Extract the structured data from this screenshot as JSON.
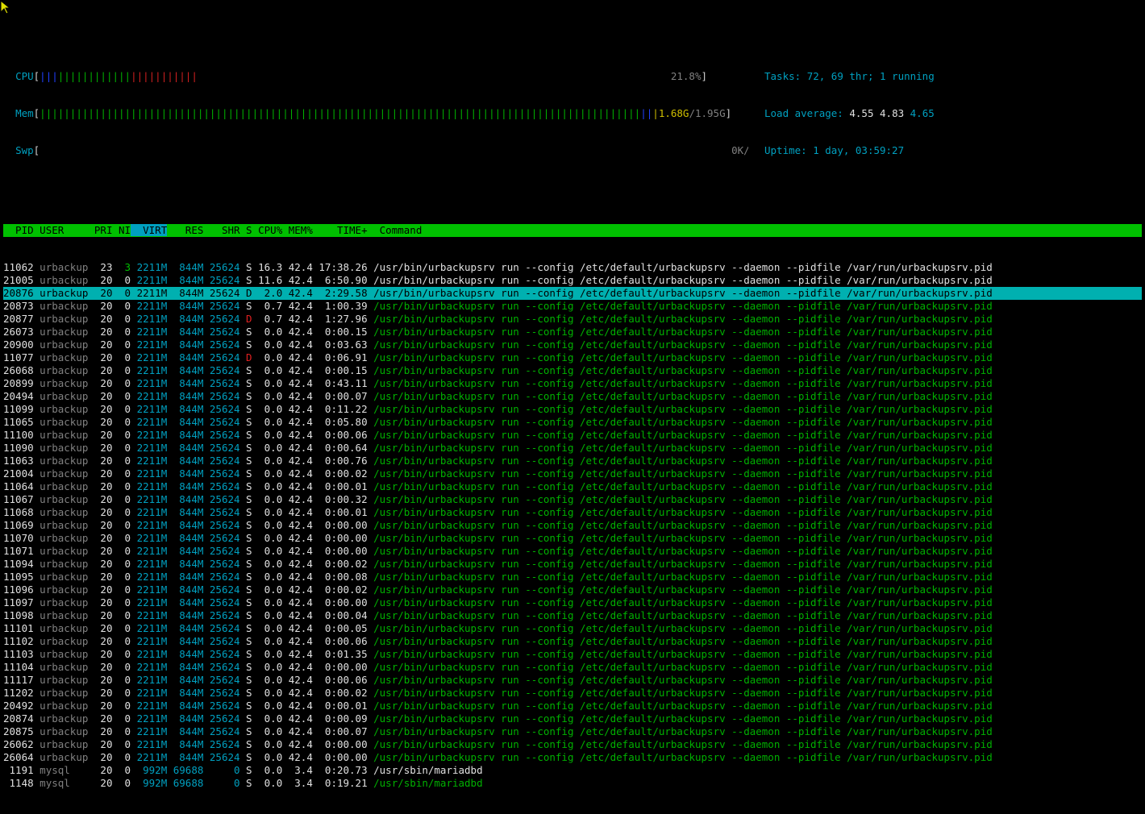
{
  "meters": {
    "cpu": {
      "label": "CPU",
      "value": "21.8%"
    },
    "mem": {
      "label": "Mem",
      "value_used": "1.68G",
      "value_total": "1.95G"
    },
    "swp": {
      "label": "Swp",
      "value": "0K/0K"
    }
  },
  "info": {
    "tasks_label": "Tasks:",
    "tasks_value": "72, 69 thr; 1 running",
    "load_label": "Load average:",
    "load_1": "4.55",
    "load_5": "4.83",
    "load_15": "4.65",
    "uptime_label": "Uptime:",
    "uptime_value": "1 day, 03:59:27"
  },
  "columns": [
    "PID",
    "USER",
    "PRI",
    "NI",
    "VIRT",
    "RES",
    "SHR",
    "S",
    "CPU%",
    "MEM%",
    "TIME+",
    "Command"
  ],
  "sorted_column": "VIRT",
  "processes": [
    {
      "pid": "11062",
      "user": "urbackup",
      "pri": "23",
      "ni": "3",
      "virt": "2211M",
      "res": "844M",
      "shr": "25624",
      "s": "S",
      "cpu": "16.3",
      "mem": "42.4",
      "time": "17:38.26",
      "cmd": "/usr/bin/urbackupsrv run --config /etc/default/urbackupsrv --daemon --pidfile /var/run/urbackupsrv.pid",
      "main": true
    },
    {
      "pid": "21005",
      "user": "urbackup",
      "pri": "20",
      "ni": "0",
      "virt": "2211M",
      "res": "844M",
      "shr": "25624",
      "s": "S",
      "cpu": "11.6",
      "mem": "42.4",
      "time": "6:50.90",
      "cmd": "/usr/bin/urbackupsrv run --config /etc/default/urbackupsrv --daemon --pidfile /var/run/urbackupsrv.pid",
      "main": true
    },
    {
      "pid": "20876",
      "user": "urbackup",
      "pri": "20",
      "ni": "0",
      "virt": "2211M",
      "res": "844M",
      "shr": "25624",
      "s": "D",
      "cpu": "2.0",
      "mem": "42.4",
      "time": "2:29.58",
      "cmd": "/usr/bin/urbackupsrv run --config /etc/default/urbackupsrv --daemon --pidfile /var/run/urbackupsrv.pid",
      "selected": true
    },
    {
      "pid": "20873",
      "user": "urbackup",
      "pri": "20",
      "ni": "0",
      "virt": "2211M",
      "res": "844M",
      "shr": "25624",
      "s": "S",
      "cpu": "0.7",
      "mem": "42.4",
      "time": "1:00.39",
      "cmd": "/usr/bin/urbackupsrv run --config /etc/default/urbackupsrv --daemon --pidfile /var/run/urbackupsrv.pid"
    },
    {
      "pid": "20877",
      "user": "urbackup",
      "pri": "20",
      "ni": "0",
      "virt": "2211M",
      "res": "844M",
      "shr": "25624",
      "s": "D",
      "cpu": "0.7",
      "mem": "42.4",
      "time": "1:27.96",
      "cmd": "/usr/bin/urbackupsrv run --config /etc/default/urbackupsrv --daemon --pidfile /var/run/urbackupsrv.pid"
    },
    {
      "pid": "26073",
      "user": "urbackup",
      "pri": "20",
      "ni": "0",
      "virt": "2211M",
      "res": "844M",
      "shr": "25624",
      "s": "S",
      "cpu": "0.0",
      "mem": "42.4",
      "time": "0:00.15",
      "cmd": "/usr/bin/urbackupsrv run --config /etc/default/urbackupsrv --daemon --pidfile /var/run/urbackupsrv.pid"
    },
    {
      "pid": "20900",
      "user": "urbackup",
      "pri": "20",
      "ni": "0",
      "virt": "2211M",
      "res": "844M",
      "shr": "25624",
      "s": "S",
      "cpu": "0.0",
      "mem": "42.4",
      "time": "0:03.63",
      "cmd": "/usr/bin/urbackupsrv run --config /etc/default/urbackupsrv --daemon --pidfile /var/run/urbackupsrv.pid"
    },
    {
      "pid": "11077",
      "user": "urbackup",
      "pri": "20",
      "ni": "0",
      "virt": "2211M",
      "res": "844M",
      "shr": "25624",
      "s": "D",
      "cpu": "0.0",
      "mem": "42.4",
      "time": "0:06.91",
      "cmd": "/usr/bin/urbackupsrv run --config /etc/default/urbackupsrv --daemon --pidfile /var/run/urbackupsrv.pid"
    },
    {
      "pid": "26068",
      "user": "urbackup",
      "pri": "20",
      "ni": "0",
      "virt": "2211M",
      "res": "844M",
      "shr": "25624",
      "s": "S",
      "cpu": "0.0",
      "mem": "42.4",
      "time": "0:00.15",
      "cmd": "/usr/bin/urbackupsrv run --config /etc/default/urbackupsrv --daemon --pidfile /var/run/urbackupsrv.pid"
    },
    {
      "pid": "20899",
      "user": "urbackup",
      "pri": "20",
      "ni": "0",
      "virt": "2211M",
      "res": "844M",
      "shr": "25624",
      "s": "S",
      "cpu": "0.0",
      "mem": "42.4",
      "time": "0:43.11",
      "cmd": "/usr/bin/urbackupsrv run --config /etc/default/urbackupsrv --daemon --pidfile /var/run/urbackupsrv.pid"
    },
    {
      "pid": "20494",
      "user": "urbackup",
      "pri": "20",
      "ni": "0",
      "virt": "2211M",
      "res": "844M",
      "shr": "25624",
      "s": "S",
      "cpu": "0.0",
      "mem": "42.4",
      "time": "0:00.07",
      "cmd": "/usr/bin/urbackupsrv run --config /etc/default/urbackupsrv --daemon --pidfile /var/run/urbackupsrv.pid"
    },
    {
      "pid": "11099",
      "user": "urbackup",
      "pri": "20",
      "ni": "0",
      "virt": "2211M",
      "res": "844M",
      "shr": "25624",
      "s": "S",
      "cpu": "0.0",
      "mem": "42.4",
      "time": "0:11.22",
      "cmd": "/usr/bin/urbackupsrv run --config /etc/default/urbackupsrv --daemon --pidfile /var/run/urbackupsrv.pid"
    },
    {
      "pid": "11065",
      "user": "urbackup",
      "pri": "20",
      "ni": "0",
      "virt": "2211M",
      "res": "844M",
      "shr": "25624",
      "s": "S",
      "cpu": "0.0",
      "mem": "42.4",
      "time": "0:05.80",
      "cmd": "/usr/bin/urbackupsrv run --config /etc/default/urbackupsrv --daemon --pidfile /var/run/urbackupsrv.pid"
    },
    {
      "pid": "11100",
      "user": "urbackup",
      "pri": "20",
      "ni": "0",
      "virt": "2211M",
      "res": "844M",
      "shr": "25624",
      "s": "S",
      "cpu": "0.0",
      "mem": "42.4",
      "time": "0:00.06",
      "cmd": "/usr/bin/urbackupsrv run --config /etc/default/urbackupsrv --daemon --pidfile /var/run/urbackupsrv.pid"
    },
    {
      "pid": "11090",
      "user": "urbackup",
      "pri": "20",
      "ni": "0",
      "virt": "2211M",
      "res": "844M",
      "shr": "25624",
      "s": "S",
      "cpu": "0.0",
      "mem": "42.4",
      "time": "0:00.64",
      "cmd": "/usr/bin/urbackupsrv run --config /etc/default/urbackupsrv --daemon --pidfile /var/run/urbackupsrv.pid"
    },
    {
      "pid": "11063",
      "user": "urbackup",
      "pri": "20",
      "ni": "0",
      "virt": "2211M",
      "res": "844M",
      "shr": "25624",
      "s": "S",
      "cpu": "0.0",
      "mem": "42.4",
      "time": "0:00.76",
      "cmd": "/usr/bin/urbackupsrv run --config /etc/default/urbackupsrv --daemon --pidfile /var/run/urbackupsrv.pid"
    },
    {
      "pid": "21004",
      "user": "urbackup",
      "pri": "20",
      "ni": "0",
      "virt": "2211M",
      "res": "844M",
      "shr": "25624",
      "s": "S",
      "cpu": "0.0",
      "mem": "42.4",
      "time": "0:00.02",
      "cmd": "/usr/bin/urbackupsrv run --config /etc/default/urbackupsrv --daemon --pidfile /var/run/urbackupsrv.pid"
    },
    {
      "pid": "11064",
      "user": "urbackup",
      "pri": "20",
      "ni": "0",
      "virt": "2211M",
      "res": "844M",
      "shr": "25624",
      "s": "S",
      "cpu": "0.0",
      "mem": "42.4",
      "time": "0:00.01",
      "cmd": "/usr/bin/urbackupsrv run --config /etc/default/urbackupsrv --daemon --pidfile /var/run/urbackupsrv.pid"
    },
    {
      "pid": "11067",
      "user": "urbackup",
      "pri": "20",
      "ni": "0",
      "virt": "2211M",
      "res": "844M",
      "shr": "25624",
      "s": "S",
      "cpu": "0.0",
      "mem": "42.4",
      "time": "0:00.32",
      "cmd": "/usr/bin/urbackupsrv run --config /etc/default/urbackupsrv --daemon --pidfile /var/run/urbackupsrv.pid"
    },
    {
      "pid": "11068",
      "user": "urbackup",
      "pri": "20",
      "ni": "0",
      "virt": "2211M",
      "res": "844M",
      "shr": "25624",
      "s": "S",
      "cpu": "0.0",
      "mem": "42.4",
      "time": "0:00.01",
      "cmd": "/usr/bin/urbackupsrv run --config /etc/default/urbackupsrv --daemon --pidfile /var/run/urbackupsrv.pid"
    },
    {
      "pid": "11069",
      "user": "urbackup",
      "pri": "20",
      "ni": "0",
      "virt": "2211M",
      "res": "844M",
      "shr": "25624",
      "s": "S",
      "cpu": "0.0",
      "mem": "42.4",
      "time": "0:00.00",
      "cmd": "/usr/bin/urbackupsrv run --config /etc/default/urbackupsrv --daemon --pidfile /var/run/urbackupsrv.pid"
    },
    {
      "pid": "11070",
      "user": "urbackup",
      "pri": "20",
      "ni": "0",
      "virt": "2211M",
      "res": "844M",
      "shr": "25624",
      "s": "S",
      "cpu": "0.0",
      "mem": "42.4",
      "time": "0:00.00",
      "cmd": "/usr/bin/urbackupsrv run --config /etc/default/urbackupsrv --daemon --pidfile /var/run/urbackupsrv.pid"
    },
    {
      "pid": "11071",
      "user": "urbackup",
      "pri": "20",
      "ni": "0",
      "virt": "2211M",
      "res": "844M",
      "shr": "25624",
      "s": "S",
      "cpu": "0.0",
      "mem": "42.4",
      "time": "0:00.00",
      "cmd": "/usr/bin/urbackupsrv run --config /etc/default/urbackupsrv --daemon --pidfile /var/run/urbackupsrv.pid"
    },
    {
      "pid": "11094",
      "user": "urbackup",
      "pri": "20",
      "ni": "0",
      "virt": "2211M",
      "res": "844M",
      "shr": "25624",
      "s": "S",
      "cpu": "0.0",
      "mem": "42.4",
      "time": "0:00.02",
      "cmd": "/usr/bin/urbackupsrv run --config /etc/default/urbackupsrv --daemon --pidfile /var/run/urbackupsrv.pid"
    },
    {
      "pid": "11095",
      "user": "urbackup",
      "pri": "20",
      "ni": "0",
      "virt": "2211M",
      "res": "844M",
      "shr": "25624",
      "s": "S",
      "cpu": "0.0",
      "mem": "42.4",
      "time": "0:00.08",
      "cmd": "/usr/bin/urbackupsrv run --config /etc/default/urbackupsrv --daemon --pidfile /var/run/urbackupsrv.pid"
    },
    {
      "pid": "11096",
      "user": "urbackup",
      "pri": "20",
      "ni": "0",
      "virt": "2211M",
      "res": "844M",
      "shr": "25624",
      "s": "S",
      "cpu": "0.0",
      "mem": "42.4",
      "time": "0:00.02",
      "cmd": "/usr/bin/urbackupsrv run --config /etc/default/urbackupsrv --daemon --pidfile /var/run/urbackupsrv.pid"
    },
    {
      "pid": "11097",
      "user": "urbackup",
      "pri": "20",
      "ni": "0",
      "virt": "2211M",
      "res": "844M",
      "shr": "25624",
      "s": "S",
      "cpu": "0.0",
      "mem": "42.4",
      "time": "0:00.00",
      "cmd": "/usr/bin/urbackupsrv run --config /etc/default/urbackupsrv --daemon --pidfile /var/run/urbackupsrv.pid"
    },
    {
      "pid": "11098",
      "user": "urbackup",
      "pri": "20",
      "ni": "0",
      "virt": "2211M",
      "res": "844M",
      "shr": "25624",
      "s": "S",
      "cpu": "0.0",
      "mem": "42.4",
      "time": "0:00.04",
      "cmd": "/usr/bin/urbackupsrv run --config /etc/default/urbackupsrv --daemon --pidfile /var/run/urbackupsrv.pid"
    },
    {
      "pid": "11101",
      "user": "urbackup",
      "pri": "20",
      "ni": "0",
      "virt": "2211M",
      "res": "844M",
      "shr": "25624",
      "s": "S",
      "cpu": "0.0",
      "mem": "42.4",
      "time": "0:00.05",
      "cmd": "/usr/bin/urbackupsrv run --config /etc/default/urbackupsrv --daemon --pidfile /var/run/urbackupsrv.pid"
    },
    {
      "pid": "11102",
      "user": "urbackup",
      "pri": "20",
      "ni": "0",
      "virt": "2211M",
      "res": "844M",
      "shr": "25624",
      "s": "S",
      "cpu": "0.0",
      "mem": "42.4",
      "time": "0:00.06",
      "cmd": "/usr/bin/urbackupsrv run --config /etc/default/urbackupsrv --daemon --pidfile /var/run/urbackupsrv.pid"
    },
    {
      "pid": "11103",
      "user": "urbackup",
      "pri": "20",
      "ni": "0",
      "virt": "2211M",
      "res": "844M",
      "shr": "25624",
      "s": "S",
      "cpu": "0.0",
      "mem": "42.4",
      "time": "0:01.35",
      "cmd": "/usr/bin/urbackupsrv run --config /etc/default/urbackupsrv --daemon --pidfile /var/run/urbackupsrv.pid"
    },
    {
      "pid": "11104",
      "user": "urbackup",
      "pri": "20",
      "ni": "0",
      "virt": "2211M",
      "res": "844M",
      "shr": "25624",
      "s": "S",
      "cpu": "0.0",
      "mem": "42.4",
      "time": "0:00.00",
      "cmd": "/usr/bin/urbackupsrv run --config /etc/default/urbackupsrv --daemon --pidfile /var/run/urbackupsrv.pid"
    },
    {
      "pid": "11117",
      "user": "urbackup",
      "pri": "20",
      "ni": "0",
      "virt": "2211M",
      "res": "844M",
      "shr": "25624",
      "s": "S",
      "cpu": "0.0",
      "mem": "42.4",
      "time": "0:00.06",
      "cmd": "/usr/bin/urbackupsrv run --config /etc/default/urbackupsrv --daemon --pidfile /var/run/urbackupsrv.pid"
    },
    {
      "pid": "11202",
      "user": "urbackup",
      "pri": "20",
      "ni": "0",
      "virt": "2211M",
      "res": "844M",
      "shr": "25624",
      "s": "S",
      "cpu": "0.0",
      "mem": "42.4",
      "time": "0:00.02",
      "cmd": "/usr/bin/urbackupsrv run --config /etc/default/urbackupsrv --daemon --pidfile /var/run/urbackupsrv.pid"
    },
    {
      "pid": "20492",
      "user": "urbackup",
      "pri": "20",
      "ni": "0",
      "virt": "2211M",
      "res": "844M",
      "shr": "25624",
      "s": "S",
      "cpu": "0.0",
      "mem": "42.4",
      "time": "0:00.01",
      "cmd": "/usr/bin/urbackupsrv run --config /etc/default/urbackupsrv --daemon --pidfile /var/run/urbackupsrv.pid"
    },
    {
      "pid": "20874",
      "user": "urbackup",
      "pri": "20",
      "ni": "0",
      "virt": "2211M",
      "res": "844M",
      "shr": "25624",
      "s": "S",
      "cpu": "0.0",
      "mem": "42.4",
      "time": "0:00.09",
      "cmd": "/usr/bin/urbackupsrv run --config /etc/default/urbackupsrv --daemon --pidfile /var/run/urbackupsrv.pid"
    },
    {
      "pid": "20875",
      "user": "urbackup",
      "pri": "20",
      "ni": "0",
      "virt": "2211M",
      "res": "844M",
      "shr": "25624",
      "s": "S",
      "cpu": "0.0",
      "mem": "42.4",
      "time": "0:00.07",
      "cmd": "/usr/bin/urbackupsrv run --config /etc/default/urbackupsrv --daemon --pidfile /var/run/urbackupsrv.pid"
    },
    {
      "pid": "26062",
      "user": "urbackup",
      "pri": "20",
      "ni": "0",
      "virt": "2211M",
      "res": "844M",
      "shr": "25624",
      "s": "S",
      "cpu": "0.0",
      "mem": "42.4",
      "time": "0:00.00",
      "cmd": "/usr/bin/urbackupsrv run --config /etc/default/urbackupsrv --daemon --pidfile /var/run/urbackupsrv.pid"
    },
    {
      "pid": "26064",
      "user": "urbackup",
      "pri": "20",
      "ni": "0",
      "virt": "2211M",
      "res": "844M",
      "shr": "25624",
      "s": "S",
      "cpu": "0.0",
      "mem": "42.4",
      "time": "0:00.00",
      "cmd": "/usr/bin/urbackupsrv run --config /etc/default/urbackupsrv --daemon --pidfile /var/run/urbackupsrv.pid"
    },
    {
      "pid": "1191",
      "user": "mysql",
      "pri": "20",
      "ni": "0",
      "virt": "992M",
      "res": "69688",
      "shr": "0",
      "s": "S",
      "cpu": "0.0",
      "mem": "3.4",
      "time": "0:20.73",
      "cmd": "/usr/sbin/mariadbd",
      "main": true
    },
    {
      "pid": "1148",
      "user": "mysql",
      "pri": "20",
      "ni": "0",
      "virt": "992M",
      "res": "69688",
      "shr": "0",
      "s": "S",
      "cpu": "0.0",
      "mem": "3.4",
      "time": "0:19.21",
      "cmd": "/usr/sbin/mariadbd"
    }
  ]
}
